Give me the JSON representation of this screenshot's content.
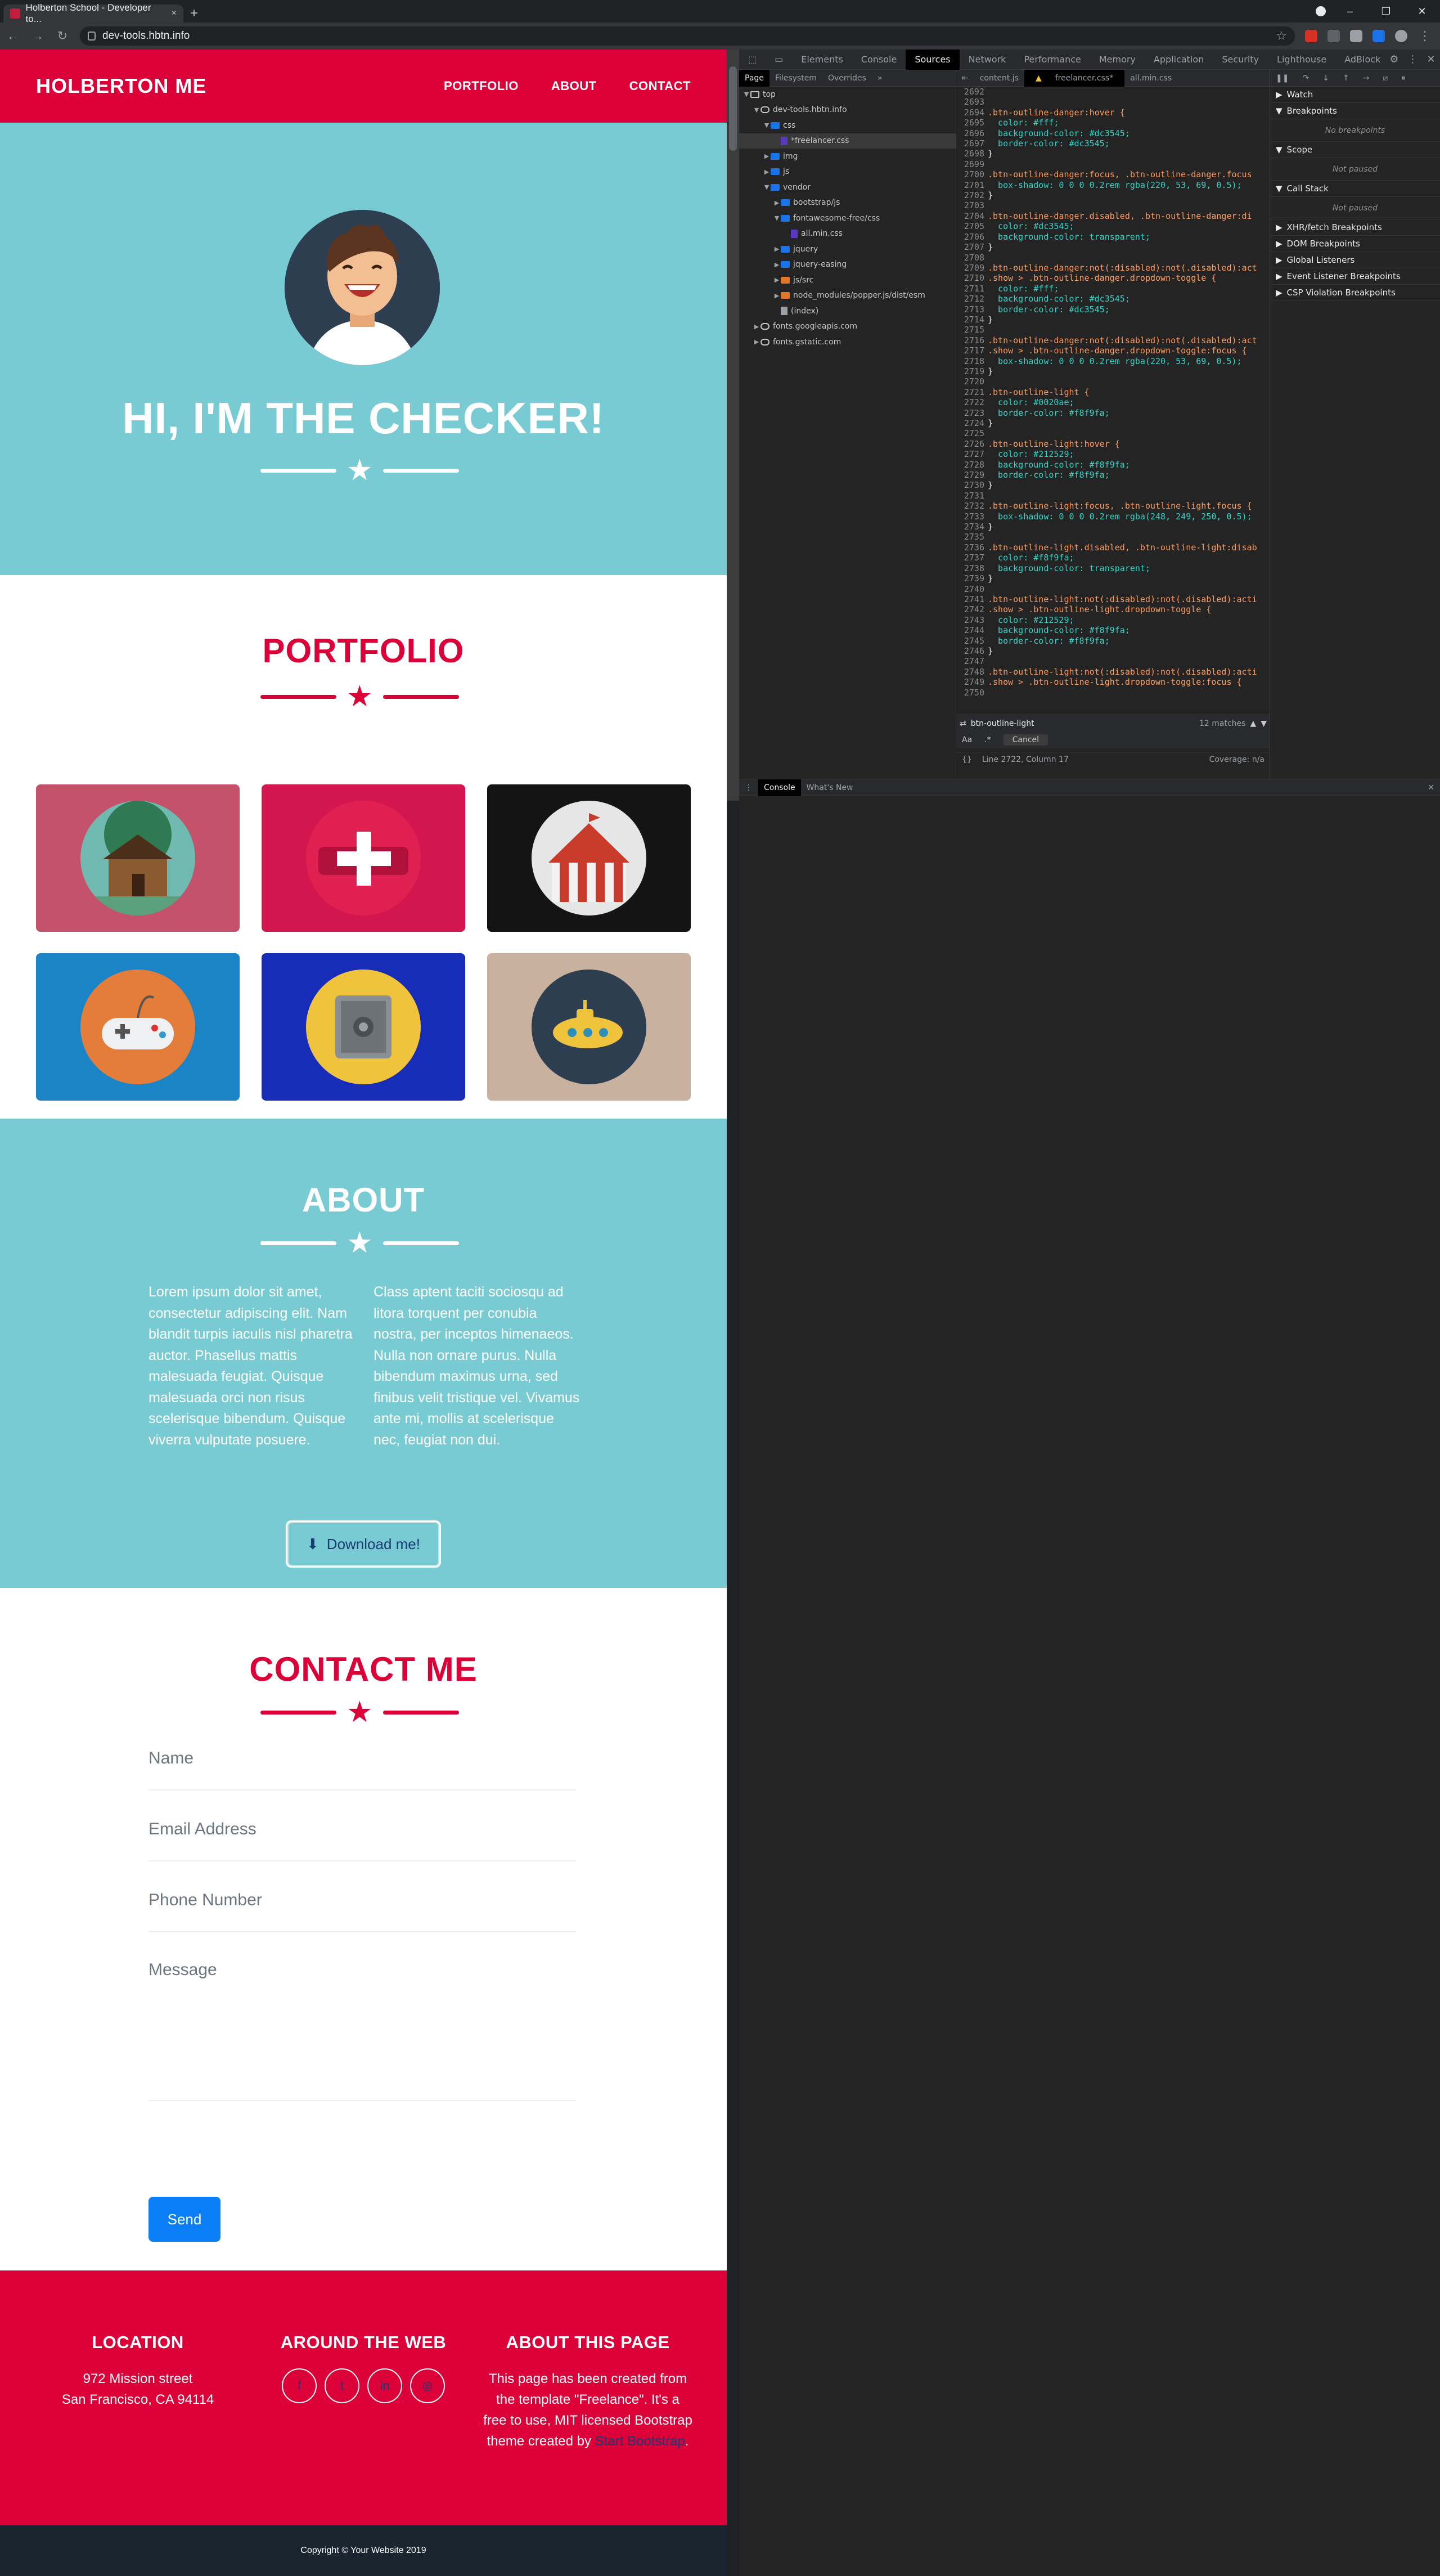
{
  "browser": {
    "tab_title": "Holberton School - Developer to...",
    "tab_close": "×",
    "new_tab": "+",
    "url": "dev-tools.hbtn.info",
    "window_minimize": "–",
    "window_maximize": "❐",
    "window_close": "✕"
  },
  "site": {
    "brand": "HOLBERTON ME",
    "nav": [
      "PORTFOLIO",
      "ABOUT",
      "CONTACT"
    ],
    "hero_title": "HI, I'M THE CHECKER!",
    "portfolio_title": "PORTFOLIO",
    "portfolio_items": [
      {
        "icon": "cabin-icon",
        "bg": "#c4526a"
      },
      {
        "icon": "first-aid-icon",
        "bg": "#d31650"
      },
      {
        "icon": "circus-tent-icon",
        "bg": "#141414"
      },
      {
        "icon": "game-controller-icon",
        "bg": "#1a84c7"
      },
      {
        "icon": "safe-icon",
        "bg": "#172db8"
      },
      {
        "icon": "submarine-icon",
        "bg": "#c9b1a0"
      }
    ],
    "about_title": "ABOUT",
    "about_left": "Lorem ipsum dolor sit amet, consectetur adipiscing elit. Nam blandit turpis iaculis nisl pharetra auctor. Phasellus mattis malesuada feugiat. Quisque malesuada orci non risus scelerisque bibendum. Quisque viverra vulputate posuere.",
    "about_right": "Class aptent taciti sociosqu ad litora torquent per conubia nostra, per inceptos himenaeos. Nulla non ornare purus. Nulla bibendum maximus urna, sed finibus velit tristique vel. Vivamus ante mi, mollis at scelerisque nec, feugiat non dui.",
    "download_label": "Download me!",
    "contact_title": "CONTACT ME",
    "fields": {
      "name": "Name",
      "email": "Email Address",
      "phone": "Phone Number",
      "message": "Message"
    },
    "send_label": "Send",
    "footer": {
      "location_title": "LOCATION",
      "location_line1": "972 Mission street",
      "location_line2": "San Francisco, CA 94114",
      "web_title": "AROUND THE WEB",
      "social": [
        "f",
        "t",
        "in",
        "◎"
      ],
      "about_title": "ABOUT THIS PAGE",
      "about_text": "This page has been created from the template \"Freelance\". It's a free to use, MIT licensed Bootstrap theme created by",
      "about_link": "Start Bootstrap",
      "about_end": ".",
      "copyright": "Copyright © Your Website 2019"
    },
    "colors": {
      "primary": "#dc0039",
      "teal": "#79cbd3",
      "dark": "#1a252f"
    }
  },
  "devtools": {
    "tabs": [
      "Elements",
      "Console",
      "Sources",
      "Network",
      "Performance",
      "Memory",
      "Application",
      "Security",
      "Lighthouse",
      "AdBlock"
    ],
    "active_tab": "Sources",
    "nav_tabs": [
      "Page",
      "Filesystem",
      "Overrides",
      "»"
    ],
    "tree": [
      {
        "label": "top",
        "indent": 0,
        "type": "frame",
        "tw": "▼"
      },
      {
        "label": "dev-tools.hbtn.info",
        "indent": 1,
        "type": "cloud",
        "tw": "▼"
      },
      {
        "label": "css",
        "indent": 2,
        "type": "folder-blue",
        "tw": "▼"
      },
      {
        "label": "*freelancer.css",
        "indent": 3,
        "type": "file",
        "tw": ""
      },
      {
        "label": "img",
        "indent": 2,
        "type": "folder-blue",
        "tw": "▶"
      },
      {
        "label": "js",
        "indent": 2,
        "type": "folder-blue",
        "tw": "▶"
      },
      {
        "label": "vendor",
        "indent": 2,
        "type": "folder-blue",
        "tw": "▼"
      },
      {
        "label": "bootstrap/js",
        "indent": 3,
        "type": "folder-blue",
        "tw": "▶"
      },
      {
        "label": "fontawesome-free/css",
        "indent": 3,
        "type": "folder-blue",
        "tw": "▼"
      },
      {
        "label": "all.min.css",
        "indent": 4,
        "type": "file",
        "tw": ""
      },
      {
        "label": "jquery",
        "indent": 3,
        "type": "folder-blue",
        "tw": "▶"
      },
      {
        "label": "jquery-easing",
        "indent": 3,
        "type": "folder-blue",
        "tw": "▶"
      },
      {
        "label": "js/src",
        "indent": 3,
        "type": "folder-orange",
        "tw": "▶"
      },
      {
        "label": "node_modules/popper.js/dist/esm",
        "indent": 3,
        "type": "folder-orange",
        "tw": "▶"
      },
      {
        "label": "(index)",
        "indent": 3,
        "type": "doc",
        "tw": ""
      },
      {
        "label": "fonts.googleapis.com",
        "indent": 1,
        "type": "cloud",
        "tw": "▶"
      },
      {
        "label": "fonts.gstatic.com",
        "indent": 1,
        "type": "cloud",
        "tw": "▶"
      }
    ],
    "editor_tabs": [
      "content.js",
      "freelancer.css*",
      "all.min.css"
    ],
    "active_editor_tab": "freelancer.css*",
    "code": [
      [
        "2692",
        ""
      ],
      [
        "2693",
        ""
      ],
      [
        "2694",
        ".btn-outline-danger:hover {"
      ],
      [
        "2695",
        "  color: #fff;"
      ],
      [
        "2696",
        "  background-color: #dc3545;"
      ],
      [
        "2697",
        "  border-color: #dc3545;"
      ],
      [
        "2698",
        "}"
      ],
      [
        "2699",
        ""
      ],
      [
        "2700",
        ".btn-outline-danger:focus, .btn-outline-danger.focus"
      ],
      [
        "2701",
        "  box-shadow: 0 0 0 0.2rem rgba(220, 53, 69, 0.5);"
      ],
      [
        "2702",
        "}"
      ],
      [
        "2703",
        ""
      ],
      [
        "2704",
        ".btn-outline-danger.disabled, .btn-outline-danger:di"
      ],
      [
        "2705",
        "  color: #dc3545;"
      ],
      [
        "2706",
        "  background-color: transparent;"
      ],
      [
        "2707",
        "}"
      ],
      [
        "2708",
        ""
      ],
      [
        "2709",
        ".btn-outline-danger:not(:disabled):not(.disabled):act"
      ],
      [
        "2710",
        ".show > .btn-outline-danger.dropdown-toggle {"
      ],
      [
        "2711",
        "  color: #fff;"
      ],
      [
        "2712",
        "  background-color: #dc3545;"
      ],
      [
        "2713",
        "  border-color: #dc3545;"
      ],
      [
        "2714",
        "}"
      ],
      [
        "2715",
        ""
      ],
      [
        "2716",
        ".btn-outline-danger:not(:disabled):not(.disabled):act"
      ],
      [
        "2717",
        ".show > .btn-outline-danger.dropdown-toggle:focus {"
      ],
      [
        "2718",
        "  box-shadow: 0 0 0 0.2rem rgba(220, 53, 69, 0.5);"
      ],
      [
        "2719",
        "}"
      ],
      [
        "2720",
        ""
      ],
      [
        "2721",
        ".btn-outline-light {"
      ],
      [
        "2722",
        "  color: #0020ae;"
      ],
      [
        "2723",
        "  border-color: #f8f9fa;"
      ],
      [
        "2724",
        "}"
      ],
      [
        "2725",
        ""
      ],
      [
        "2726",
        ".btn-outline-light:hover {"
      ],
      [
        "2727",
        "  color: #212529;"
      ],
      [
        "2728",
        "  background-color: #f8f9fa;"
      ],
      [
        "2729",
        "  border-color: #f8f9fa;"
      ],
      [
        "2730",
        "}"
      ],
      [
        "2731",
        ""
      ],
      [
        "2732",
        ".btn-outline-light:focus, .btn-outline-light.focus {"
      ],
      [
        "2733",
        "  box-shadow: 0 0 0 0.2rem rgba(248, 249, 250, 0.5);"
      ],
      [
        "2734",
        "}"
      ],
      [
        "2735",
        ""
      ],
      [
        "2736",
        ".btn-outline-light.disabled, .btn-outline-light:disab"
      ],
      [
        "2737",
        "  color: #f8f9fa;"
      ],
      [
        "2738",
        "  background-color: transparent;"
      ],
      [
        "2739",
        "}"
      ],
      [
        "2740",
        ""
      ],
      [
        "2741",
        ".btn-outline-light:not(:disabled):not(.disabled):acti"
      ],
      [
        "2742",
        ".show > .btn-outline-light.dropdown-toggle {"
      ],
      [
        "2743",
        "  color: #212529;"
      ],
      [
        "2744",
        "  background-color: #f8f9fa;"
      ],
      [
        "2745",
        "  border-color: #f8f9fa;"
      ],
      [
        "2746",
        "}"
      ],
      [
        "2747",
        ""
      ],
      [
        "2748",
        ".btn-outline-light:not(:disabled):not(.disabled):acti"
      ],
      [
        "2749",
        ".show > .btn-outline-light.dropdown-toggle:focus {"
      ],
      [
        "2750",
        ""
      ]
    ],
    "search_value": "btn-outline-light",
    "search_count": "12 matches",
    "search_aa": "Aa",
    "search_regex": ".*",
    "search_cancel": "Cancel",
    "status_left": "{}",
    "status_position": "Line 2722, Column 17",
    "status_coverage": "Coverage: n/a",
    "debugger": {
      "watch": "Watch",
      "breakpoints": "Breakpoints",
      "no_breakpoints": "No breakpoints",
      "scope": "Scope",
      "not_paused": "Not paused",
      "call_stack": "Call Stack",
      "not_paused_2": "Not paused",
      "sections": [
        "XHR/fetch Breakpoints",
        "DOM Breakpoints",
        "Global Listeners",
        "Event Listener Breakpoints",
        "CSP Violation Breakpoints"
      ]
    },
    "drawer_tabs": [
      "Console",
      "What's New"
    ],
    "drawer_close": "✕"
  }
}
